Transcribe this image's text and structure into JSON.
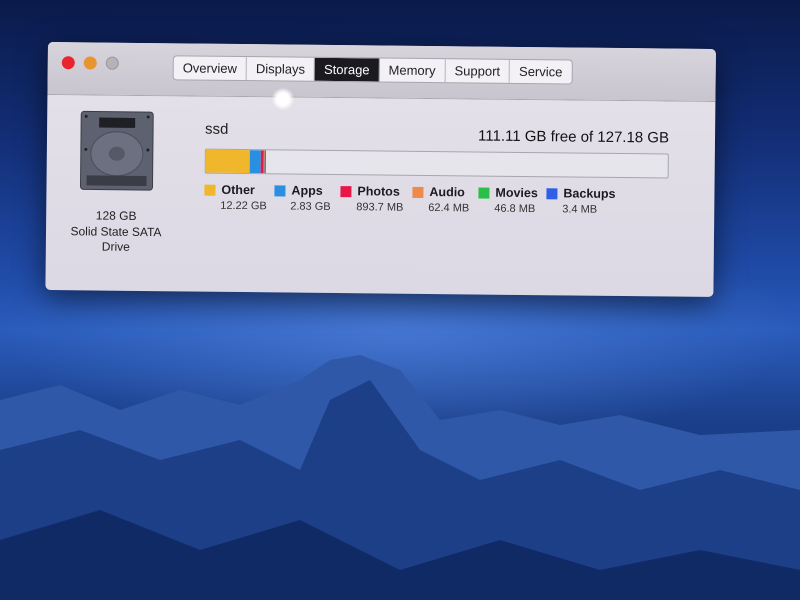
{
  "window": {
    "tabs": [
      {
        "label": "Overview",
        "active": false
      },
      {
        "label": "Displays",
        "active": false
      },
      {
        "label": "Storage",
        "active": true
      },
      {
        "label": "Memory",
        "active": false
      },
      {
        "label": "Support",
        "active": false
      },
      {
        "label": "Service",
        "active": false
      }
    ]
  },
  "disk": {
    "icon": "hard-drive-icon",
    "capacity": "128 GB",
    "type_line1": "Solid State SATA",
    "type_line2": "Drive"
  },
  "volume": {
    "name": "ssd",
    "free_text": "111.11 GB free of 127.18 GB",
    "total_gb": 127.18,
    "categories": [
      {
        "label": "Other",
        "size": "12.22 GB",
        "gb": 12.22,
        "color": "#f0b62c"
      },
      {
        "label": "Apps",
        "size": "2.83 GB",
        "gb": 2.83,
        "color": "#2a8fe0"
      },
      {
        "label": "Photos",
        "size": "893.7 MB",
        "gb": 0.8937,
        "color": "#e8174a"
      },
      {
        "label": "Audio",
        "size": "62.4 MB",
        "gb": 0.0624,
        "color": "#f08a4a"
      },
      {
        "label": "Movies",
        "size": "46.8 MB",
        "gb": 0.0468,
        "color": "#2bbf4a"
      },
      {
        "label": "Backups",
        "size": "3.4 MB",
        "gb": 0.0034,
        "color": "#2f5fe6"
      }
    ]
  }
}
